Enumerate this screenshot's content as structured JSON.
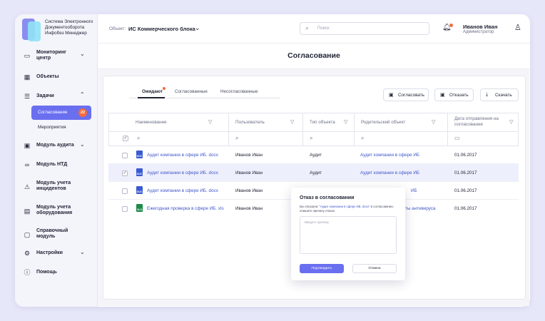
{
  "logo": {
    "text": "Система Электронного Документооборота Инфобез Менеджер"
  },
  "sidebar": {
    "items": [
      {
        "label": "Мониторинг центр",
        "icon": "monitor-icon",
        "chevron": true
      },
      {
        "label": "Объекты",
        "icon": "grid-icon",
        "chevron": false
      },
      {
        "label": "Задачи",
        "icon": "tasks-icon",
        "chevron": true,
        "expanded": true
      },
      {
        "label": "Модуль аудита",
        "icon": "folder-icon",
        "chevron": true
      },
      {
        "label": "Модуль НТД",
        "icon": "link-icon",
        "chevron": false
      },
      {
        "label": "Модуль учета инцидентов",
        "icon": "warning-icon",
        "chevron": false
      },
      {
        "label": "Модуль учета оборудования",
        "icon": "clipboard-icon",
        "chevron": false
      },
      {
        "label": "Справочный модуль",
        "icon": "chat-icon",
        "chevron": false
      },
      {
        "label": "Настройки",
        "icon": "gear-icon",
        "chevron": true
      },
      {
        "label": "Помощь",
        "icon": "info-icon",
        "chevron": false
      }
    ],
    "sub_active": {
      "label": "Согласование",
      "badge": "22"
    },
    "sub_item": "Мероприятия"
  },
  "header": {
    "object_label": "Объект:",
    "object_value": "ИС Коммерческого блока",
    "search_placeholder": "Поиск",
    "user_name": "Иванов Иван",
    "user_role": "Администратор"
  },
  "page": {
    "title": "Согласование"
  },
  "tabs": [
    "Ожидают",
    "Согласованные",
    "Несогласованные"
  ],
  "actions": {
    "approve": "Согласовать",
    "reject": "Отказать",
    "download": "Скачать"
  },
  "table": {
    "columns": [
      "Наименование",
      "Пользователь",
      "Тип объекта",
      "Родительский объект",
      "Дата отправления на согласование"
    ],
    "rows": [
      {
        "name": "Аудит компании в сфере ИБ. docx",
        "file": "DOC",
        "user": "Иванов Иван",
        "type": "Аудит",
        "parent": "Аудит компании в сфере ИБ",
        "date": "01.06.2017",
        "selected": false
      },
      {
        "name": "Аудит компании в сфере ИБ. docx",
        "file": "DOC",
        "user": "Иванов Иван",
        "type": "Аудит",
        "parent": "Аудит компании в сфере ИБ",
        "date": "01.06.2017",
        "selected": true
      },
      {
        "name": "Аудит компании в сфере ИБ. docx",
        "file": "DOC",
        "user": "Иванов Иван",
        "type": "",
        "parent": "ИБ",
        "date": "01.06.2017",
        "selected": false
      },
      {
        "name": "Ежегодная проверка в сфере ИБ. xls",
        "file": "XLS",
        "user": "Иванов Иван",
        "type": "",
        "parent": "боты антивируса",
        "date": "01.06.2017",
        "selected": false
      }
    ]
  },
  "dialog": {
    "title": "Отказ в согласовании",
    "message_pre": "Вы отказали: ",
    "message_doc": "\"Аудит компании в сфере ИБ. docx\"",
    "message_post": " в согласовании, опишите причину отказа",
    "placeholder": "Введите причину",
    "confirm": "Подтвердить",
    "cancel": "Отмена"
  },
  "colors": {
    "accent": "#6a6ff0",
    "badge": "#f56b3a",
    "link": "#3f56c9"
  }
}
